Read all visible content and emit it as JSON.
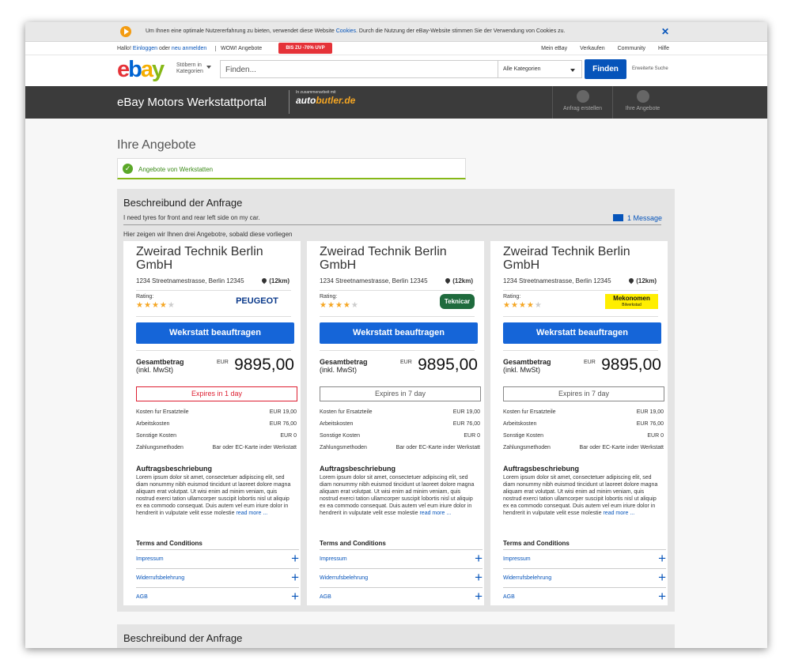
{
  "cookie_bar": {
    "text_before": "Um Ihnen eine optimale Nutzererfahrung zu bieten, verwendet diese Website ",
    "link": "Cookies",
    "text_after": ". Durch die Nutzung der eBay-Website stimmen Sie der Verwendung von Cookies zu.",
    "close": "✕"
  },
  "toplinks": {
    "hello": "Hallo!",
    "login": "Einloggen",
    "or": "oder",
    "register": "neu anmelden",
    "wow": "WOW! Angebote",
    "promo": "BIS ZU -70% UVP",
    "right": [
      "Mein eBay",
      "Verkaufen",
      "Community",
      "Hilfe"
    ]
  },
  "header": {
    "browse_line1": "Stöbern in",
    "browse_line2": "Kategorien",
    "search_placeholder": "Finden...",
    "category": "Alle Kategorien",
    "find_button": "Finden",
    "advanced": "Erweiterte Suche"
  },
  "portal": {
    "title": "eBay Motors Werkstattportal",
    "coop_small": "In zusammenarbeit mit",
    "coop_brand_1": "auto",
    "coop_brand_2": "butler.de",
    "btn_request": "Anfrag erstellen",
    "btn_offers": "Ihre Angebote"
  },
  "page": {
    "title": "Ihre Angebote",
    "filter": "Angebote von Werkstatten"
  },
  "request": {
    "title": "Beschreibund der Anfrage",
    "description": "I need tyres for front and rear left side on my car.",
    "message": "1 Message",
    "hint": "Hier zeigen wir Ihnen drei Angebotre, sobald diese vorliegen"
  },
  "common": {
    "rating_label": "Rating:",
    "book_button": "Wekrstatt beauftragen",
    "total_label": "Gesamtbetrag",
    "total_sub": "(inkl. MwSt)",
    "currency": "EUR",
    "order_desc_title": "Auftragsbeschriebung",
    "lorem": "Lorem ipsum dolor sit amet, consectetuer adipiscing elit, sed diam nonummy nibh euismod tincidunt ut laoreet dolore magna aliquam erat volutpat. Ut wisi enim ad minim veniam, quis nostrud exerci tation ullamcorper suscipit lobortis nisl ut aliquip ex ea commodo consequat. Duis autem vel eum iriure dolor in hendrerit in vulputate velit esse molestie ",
    "read_more": "read more ...",
    "terms_title": "Terms and Conditions",
    "terms": [
      "Impressum",
      "Widerrufsbelehrung",
      "AGB"
    ]
  },
  "offers": [
    {
      "name": "Zweirad Technik Berlin GmbH",
      "address": "1234 Streetnamestrasse, Berlin 12345",
      "distance": "(12km)",
      "rating": 4,
      "brand": "PEUGEOT",
      "amount": "9895,00",
      "expires": "Expires in 1 day",
      "costs": [
        {
          "label": "Kosten fur Ersatzteile",
          "value": "EUR 19,00"
        },
        {
          "label": "Arbeitskosten",
          "value": "EUR 76,00"
        },
        {
          "label": "Sonstige Kosten",
          "value": "EUR 0"
        },
        {
          "label": "Zahlungsmethoden",
          "value": "Bar oder EC-Karte inder Werkstatt"
        }
      ]
    },
    {
      "name": "Zweirad Technik Berlin GmbH",
      "address": "1234 Streetnamestrasse, Berlin 12345",
      "distance": "(12km)",
      "rating": 4,
      "brand": "Teknicar",
      "amount": "9895,00",
      "expires": "Expires in 7 day",
      "costs": [
        {
          "label": "Kosten fur Ersatzteile",
          "value": "EUR 19,00"
        },
        {
          "label": "Arbeitskosten",
          "value": "EUR 76,00"
        },
        {
          "label": "Sonstige Kosten",
          "value": "EUR 0"
        },
        {
          "label": "Zahlungsmethoden",
          "value": "Bar oder EC-Karte inder Werkstatt"
        }
      ]
    },
    {
      "name": "Zweirad Technik Berlin GmbH",
      "address": "1234 Streetnamestrasse, Berlin 12345",
      "distance": "(12km)",
      "rating": 4,
      "brand": "Mekonomen",
      "brand_sub": "Bilverkstad",
      "amount": "9895,00",
      "expires": "Expires in 7 day",
      "costs": [
        {
          "label": "Kosten fur Ersatzteile",
          "value": "EUR 19,00"
        },
        {
          "label": "Arbeitskosten",
          "value": "EUR 76,00"
        },
        {
          "label": "Sonstige Kosten",
          "value": "EUR 0"
        },
        {
          "label": "Zahlungsmethoden",
          "value": "Bar oder EC-Karte inder Werkstatt"
        }
      ]
    }
  ],
  "request2": {
    "title": "Beschreibund der Anfrage"
  },
  "colors": {
    "ebay_blue": "#0654ba",
    "button_blue": "#1565d8",
    "expires_red": "#dd1e31",
    "success_green": "#5ba829"
  }
}
